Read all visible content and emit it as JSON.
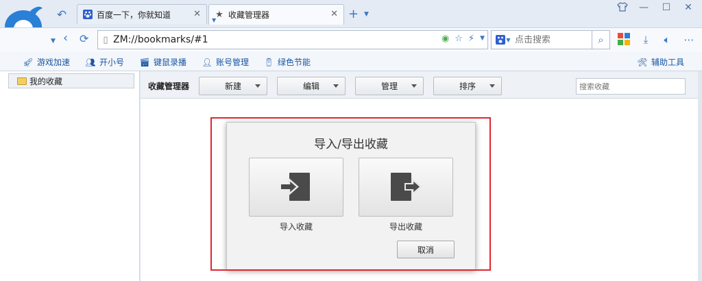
{
  "tabs": [
    {
      "label": "百度一下，你就知道",
      "close": "✕"
    },
    {
      "label": "收藏管理器",
      "close": "✕"
    }
  ],
  "address": {
    "url": "ZM://bookmarks/#1"
  },
  "search": {
    "placeholder": "点击搜索"
  },
  "plugins": [
    {
      "label": "游戏加速"
    },
    {
      "label": "开小号"
    },
    {
      "label": "键鼠录播"
    },
    {
      "label": "账号管理"
    },
    {
      "label": "绿色节能"
    },
    {
      "label": "辅助工具"
    }
  ],
  "sidebar": {
    "folder": "我的收藏"
  },
  "manager": {
    "title": "收藏管理器",
    "buttons": [
      "新建",
      "编辑",
      "管理",
      "排序"
    ],
    "search_placeholder": "搜索收藏"
  },
  "dialog": {
    "title": "导入/导出收藏",
    "import_label": "导入收藏",
    "export_label": "导出收藏",
    "cancel_label": "取消"
  },
  "colors": {
    "accent": "#3b78c4",
    "highlight": "#e0252e",
    "link": "#1a56a5"
  }
}
